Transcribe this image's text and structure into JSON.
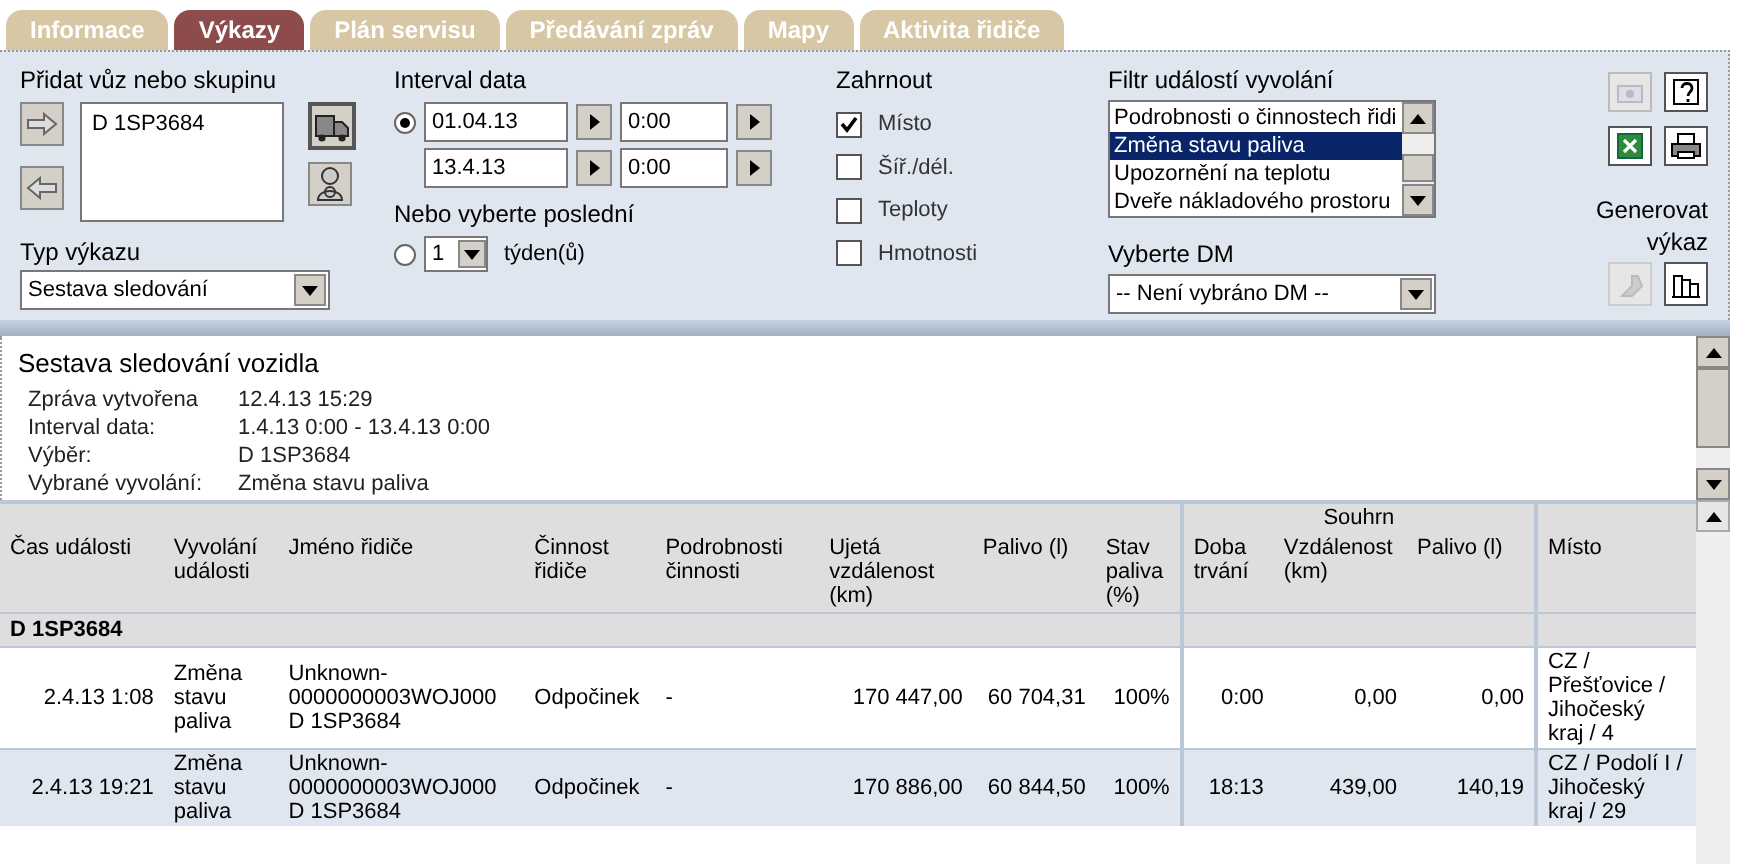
{
  "tabs": [
    {
      "label": "Informace",
      "selected": false
    },
    {
      "label": "Výkazy",
      "selected": true
    },
    {
      "label": "Plán servisu",
      "selected": false
    },
    {
      "label": "Předávání zpráv",
      "selected": false
    },
    {
      "label": "Mapy",
      "selected": false
    },
    {
      "label": "Aktivita řidiče",
      "selected": false
    }
  ],
  "vehicles": {
    "label": "Přidat vůz nebo skupinu",
    "items": [
      "D 1SP3684"
    ]
  },
  "report_type": {
    "label": "Typ výkazu",
    "value": "Sestava sledování"
  },
  "interval": {
    "label": "Interval data",
    "range_selected": true,
    "from_date": "01.04.13",
    "from_time": "0:00",
    "to_date": "13.4.13",
    "to_time": "0:00"
  },
  "last": {
    "label": "Nebo vyberte poslední",
    "selected": false,
    "value": "1",
    "unit": "týden(ů)"
  },
  "include": {
    "label": "Zahrnout",
    "options": [
      {
        "label": "Místo",
        "checked": true
      },
      {
        "label": "Šíř./dél.",
        "checked": false
      },
      {
        "label": "Teploty",
        "checked": false
      },
      {
        "label": "Hmotnosti",
        "checked": false
      }
    ]
  },
  "event_filter": {
    "label": "Filtr událostí vyvolání",
    "items": [
      {
        "label": "Podrobnosti o činnostech řidi",
        "selected": false
      },
      {
        "label": "Změna stavu paliva",
        "selected": true
      },
      {
        "label": "Upozornění na teplotu",
        "selected": false
      },
      {
        "label": "Dveře nákladového prostoru",
        "selected": false
      }
    ]
  },
  "dm": {
    "label": "Vyberte DM",
    "value": "-- Není vybráno DM --"
  },
  "generate": {
    "label": "Generovat výkaz"
  },
  "report": {
    "title": "Sestava sledování vozidla",
    "info": [
      {
        "label": "Zpráva vytvořena",
        "value": "12.4.13 15:29"
      },
      {
        "label": "Interval data:",
        "value": "1.4.13 0:00 - 13.4.13 0:00"
      },
      {
        "label": "Výběr:",
        "value": "D 1SP3684"
      },
      {
        "label": "Vybrané vyvolání:",
        "value": "Změna stavu paliva"
      }
    ]
  },
  "table": {
    "columns": [
      "Čas události",
      "Vyvolání události",
      "Jméno řidiče",
      "Činnost řidiče",
      "Podrobnosti činnosti",
      "Ujetá vzdálenost (km)",
      "Palivo (l)",
      "Stav paliva (%)"
    ],
    "summary": {
      "label": "Souhrn",
      "columns": [
        "Doba trvání",
        "Vzdálenost (km)",
        "Palivo (l)"
      ]
    },
    "last_columns": [
      "Místo"
    ],
    "groups": [
      {
        "name": "D 1SP3684",
        "rows": [
          [
            "2.4.13 1:08",
            "Změna stavu paliva",
            "Unknown-0000000003WOJ000 D 1SP3684",
            "Odpočinek",
            "-",
            "170 447,00",
            "60 704,31",
            "100%",
            "0:00",
            "0,00",
            "0,00",
            "CZ / Přešťovice / Jihočeský kraj / 4"
          ],
          [
            "2.4.13 19:21",
            "Změna stavu paliva",
            "Unknown-0000000003WOJ000 D 1SP3684",
            "Odpočinek",
            "-",
            "170 886,00",
            "60 844,50",
            "100%",
            "18:13",
            "439,00",
            "140,19",
            "CZ / Podolí I / Jihočeský kraj / 29"
          ]
        ]
      }
    ]
  }
}
